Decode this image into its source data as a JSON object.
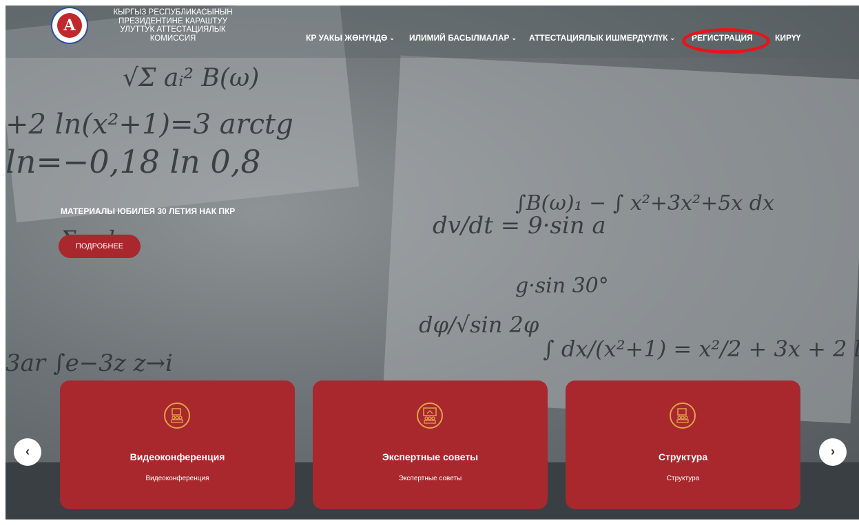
{
  "header": {
    "logo_letter": "A",
    "org_name": [
      "КЫРГЫЗ РЕСПУБЛИКАСЫНЫН",
      "ПРЕЗИДЕНТИНЕ КАРАШТУУ",
      "УЛУТТУК АТТЕСТАЦИЯЛЫК",
      "КОМИССИЯ"
    ]
  },
  "nav": {
    "about": "КР УАКЫ ЖӨНҮНДӨ",
    "publications": "ИЛИМИЙ БАСЫЛМАЛАР",
    "attestation": "АТТЕСТАЦИЯЛЫК ИШМЕРДҮҮЛҮК",
    "registration": "РЕГИСТРАЦИЯ",
    "login": "КИРҮҮ"
  },
  "hero": {
    "headline": "МАТЕРИАЛЫ ЮБИЛЕЯ 30 ЛЕТИЯ НАК ПКР",
    "button": "ПОДРОБНЕЕ"
  },
  "cards": [
    {
      "title": "Видеоконференция",
      "subtitle": "Видеоконференция"
    },
    {
      "title": "Экспертные советы",
      "subtitle": "Экспертные советы"
    },
    {
      "title": "Структура",
      "subtitle": "Структура"
    }
  ],
  "carousel": {
    "prev": "‹",
    "next": "›"
  },
  "colors": {
    "accent": "#a8282d",
    "highlight_ring": "#e8141c",
    "icon_outline": "#e3a14a"
  }
}
